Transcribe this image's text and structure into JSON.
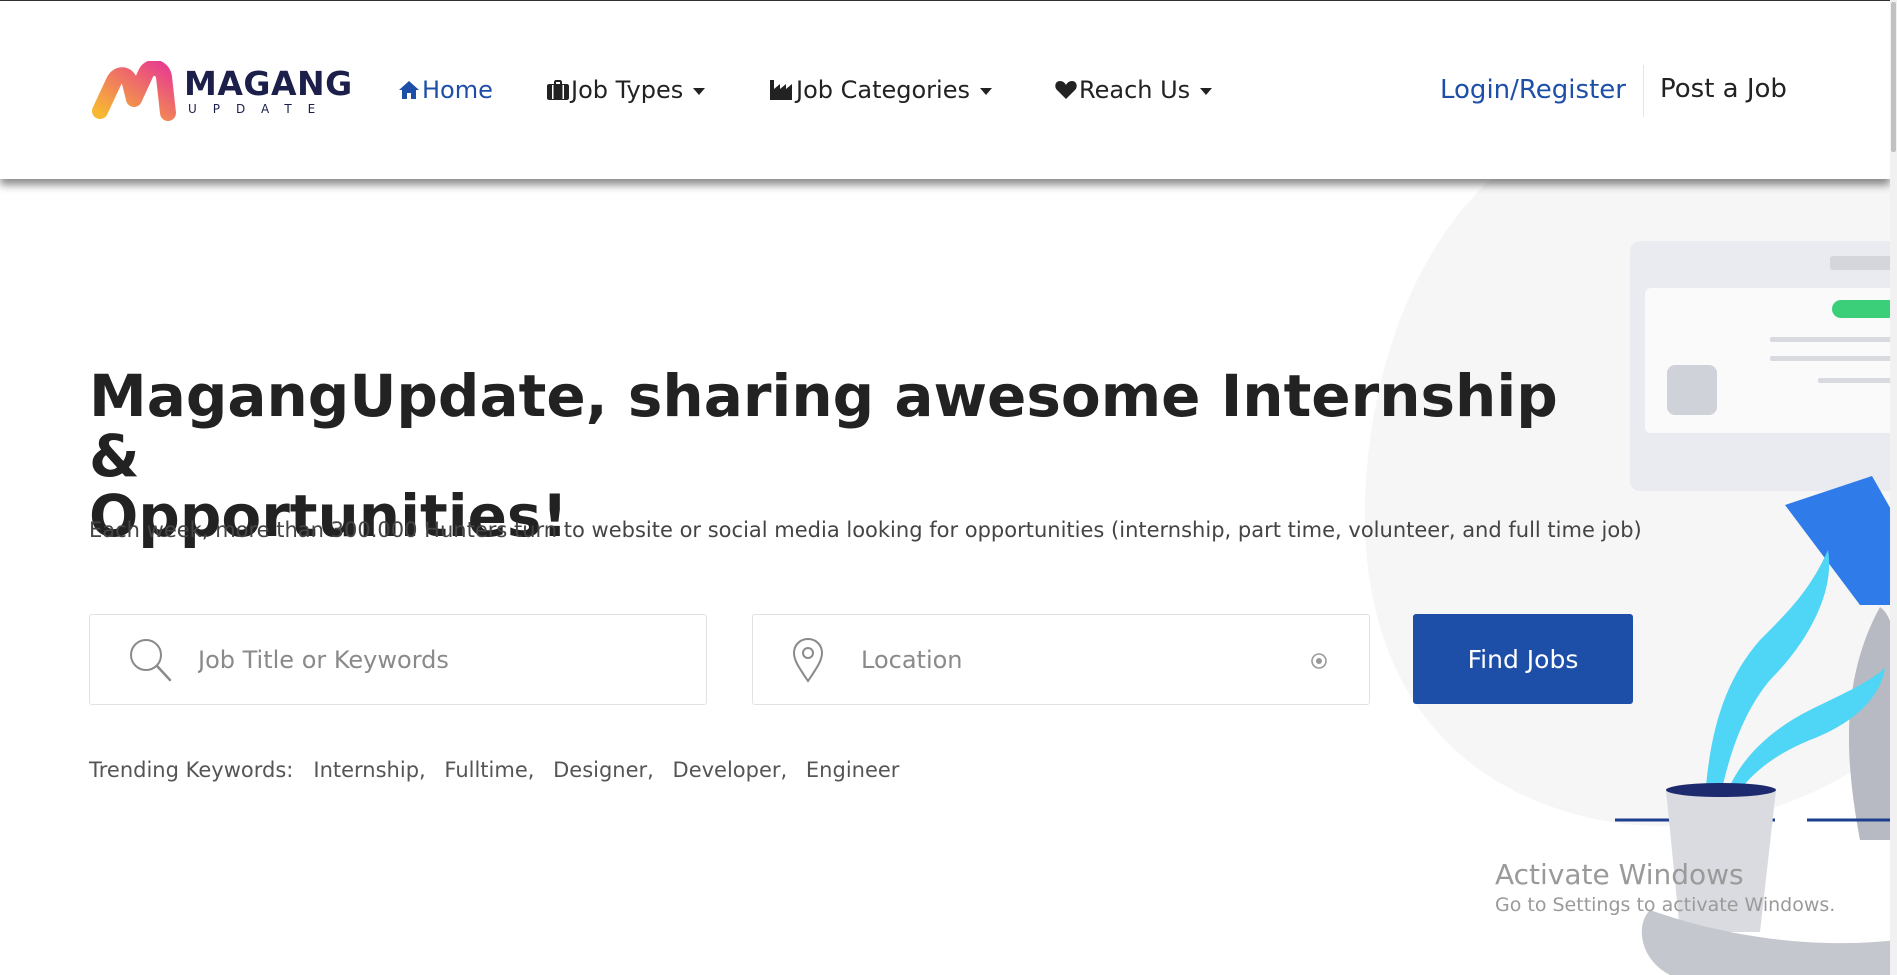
{
  "brand": {
    "name": "MAGANG",
    "sub": "UPDATE",
    "gradient_start": "#f7b733",
    "gradient_end": "#e83e8c",
    "dark": "#1b1f4a"
  },
  "nav": {
    "home": "Home",
    "job_types": "Job Types",
    "job_categories": "Job Categories",
    "reach_us": "Reach Us",
    "login": "Login/Register",
    "post_job": "Post a Job"
  },
  "hero": {
    "title_line1": "MagangUpdate, sharing awesome Internship &",
    "title_line2": "Opportunities!",
    "subtitle": "Each week, more than 300.000 Hunters turn to website or social media looking for opportunities (internship, part time, volunteer, and full time job)"
  },
  "search": {
    "keyword_placeholder": "Job Title or Keywords",
    "keyword_value": "",
    "location_placeholder": "Location",
    "location_value": "",
    "button": "Find Jobs"
  },
  "trending": {
    "label": "Trending Keywords:",
    "keywords": [
      "Internship,",
      "Fulltime,",
      "Designer,",
      "Developer,",
      "Engineer"
    ]
  },
  "watermark": {
    "title": "Activate Windows",
    "subtitle": "Go to Settings to activate Windows."
  },
  "colors": {
    "accent": "#1e4fa8",
    "text": "#222222",
    "illustration_blue": "#2f7bea",
    "illustration_cyan": "#4fd5f5",
    "illustration_green": "#3ccf7a"
  },
  "icons": {
    "home": "home-icon",
    "job_types": "briefcase-icon",
    "job_categories": "factory-icon",
    "reach_us": "heart-icon",
    "keyword": "search-icon",
    "location": "map-pin-icon",
    "locate": "locate-icon"
  }
}
